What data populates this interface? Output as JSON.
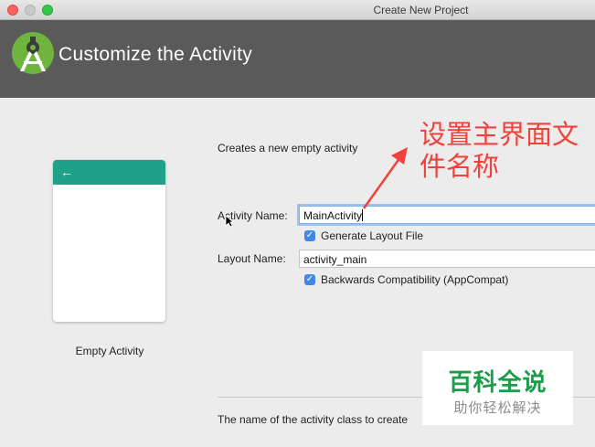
{
  "window": {
    "title": "Create New Project"
  },
  "header": {
    "title": "Customize the Activity"
  },
  "template": {
    "label": "Empty Activity",
    "back_icon": "arrow-left-icon",
    "accent": "#1fa088"
  },
  "form": {
    "description": "Creates a new empty activity",
    "activity_name_label": "Activity Name:",
    "activity_name_value": "MainActivity",
    "generate_layout_label": "Generate Layout File",
    "generate_layout_checked": true,
    "layout_name_label": "Layout Name:",
    "layout_name_value": "activity_main",
    "backwards_compat_label": "Backwards Compatibility (AppCompat)",
    "backwards_compat_checked": true
  },
  "help_text": "The name of the activity class to create",
  "annotation": {
    "text": "设置主界面文件名称",
    "color": "#f0423a"
  },
  "watermark": {
    "main": "百科全说",
    "sub": "助你轻松解决"
  }
}
